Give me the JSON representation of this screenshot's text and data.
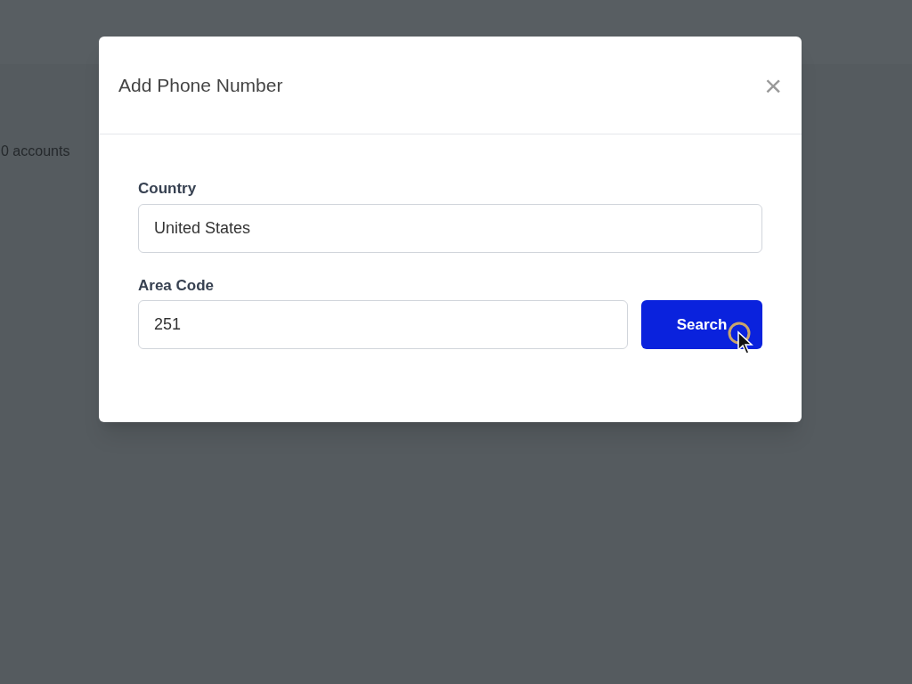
{
  "background": {
    "account_count": "0 accounts"
  },
  "modal": {
    "title": "Add Phone Number",
    "close": "×",
    "fields": [
      {
        "label": "Country",
        "value": "United States"
      },
      {
        "label": "Area Code",
        "value": "251"
      }
    ],
    "button": "Search"
  }
}
